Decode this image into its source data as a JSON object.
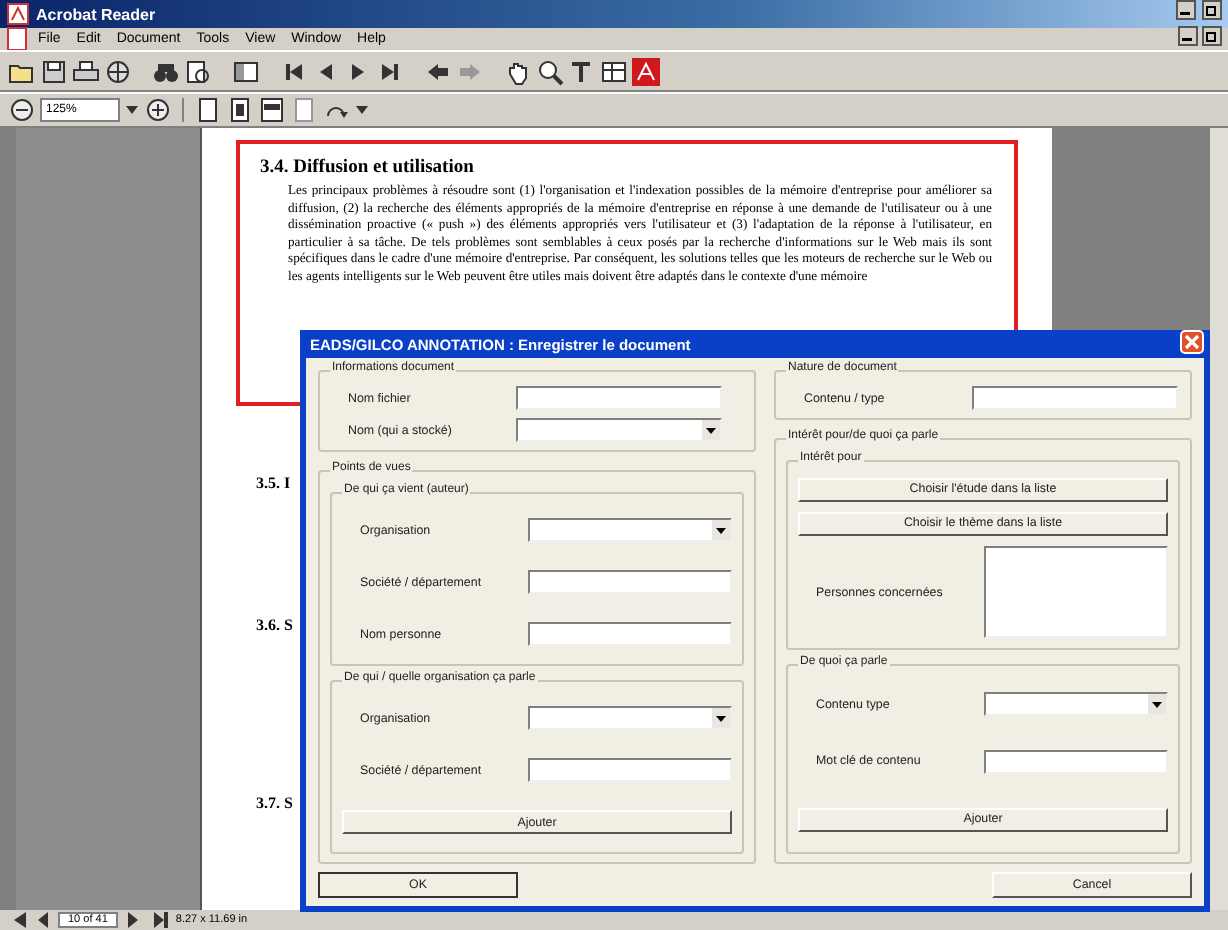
{
  "window": {
    "title": "Acrobat Reader"
  },
  "menu": [
    "File",
    "Edit",
    "Document",
    "Tools",
    "View",
    "Window",
    "Help"
  ],
  "zoom_field": {
    "value": "125%"
  },
  "document": {
    "heading": "3.4. Diffusion et utilisation",
    "paragraph": "Les principaux problèmes à résoudre sont (1) l'organisation et l'indexation possibles de la mémoire d'entreprise pour améliorer sa diffusion, (2) la recherche des éléments appropriés de la mémoire d'entreprise en réponse à une demande de l'utilisateur ou à une dissémination proactive (« push ») des éléments appropriés vers l'utilisateur et (3) l'adaptation de la réponse à l'utilisateur, en particulier à sa tâche. De tels problèmes sont semblables à ceux posés par la recherche d'informations sur le Web mais ils sont spécifiques dans le cadre d'une mémoire d'entreprise. Par conséquent, les solutions telles que les moteurs de recherche sur le Web ou les agents intelligents sur le Web peuvent être utiles mais doivent être adaptés dans le contexte d'une mémoire",
    "later_headings": [
      "3.5. I",
      "3.6. S",
      "3.7. S"
    ]
  },
  "dialog": {
    "title": "EADS/GILCO ANNOTATION : Enregistrer le document",
    "left_column": [
      {
        "kind": "group",
        "title": "Informations document",
        "items": [
          {
            "kind": "text",
            "label": "Nom fichier"
          },
          {
            "kind": "dropdown",
            "label": "Nom (qui a stocké)"
          }
        ]
      },
      {
        "kind": "group",
        "title": "Points de vues",
        "items": [
          {
            "kind": "group",
            "title": "De qui ça vient (auteur)",
            "items": [
              {
                "kind": "dropdown",
                "label": "Organisation"
              },
              {
                "kind": "text",
                "label": "Société / département"
              },
              {
                "kind": "text",
                "label": "Nom personne"
              }
            ]
          },
          {
            "kind": "group",
            "title": "De qui / quelle organisation ça parle",
            "items": [
              {
                "kind": "dropdown",
                "label": "Organisation"
              },
              {
                "kind": "text",
                "label": "Société / département"
              },
              {
                "kind": "button",
                "label": "Ajouter"
              }
            ]
          }
        ]
      }
    ],
    "right_column": [
      {
        "kind": "group",
        "title": "Nature de document",
        "items": [
          {
            "kind": "text",
            "label": "Contenu / type"
          }
        ]
      },
      {
        "kind": "group",
        "title": "Intérêt pour/de quoi ça parle",
        "items": [
          {
            "kind": "group",
            "title": "Intérêt pour",
            "items": [
              {
                "kind": "button",
                "label": "Choisir l'étude dans la liste"
              },
              {
                "kind": "button",
                "label": "Choisir le thème dans la liste"
              },
              {
                "kind": "list",
                "label": "Personnes concernées"
              }
            ]
          },
          {
            "kind": "group",
            "title": "De quoi ça parle",
            "items": [
              {
                "kind": "dropdown",
                "label": "Contenu type"
              },
              {
                "kind": "text",
                "label": "Mot clé de contenu"
              },
              {
                "kind": "button",
                "label": "Ajouter"
              }
            ]
          }
        ]
      }
    ],
    "ok": "OK",
    "cancel": "Cancel"
  },
  "status_bar": {
    "page": "10 of 41",
    "size": "8.27 x 11.69 in"
  }
}
